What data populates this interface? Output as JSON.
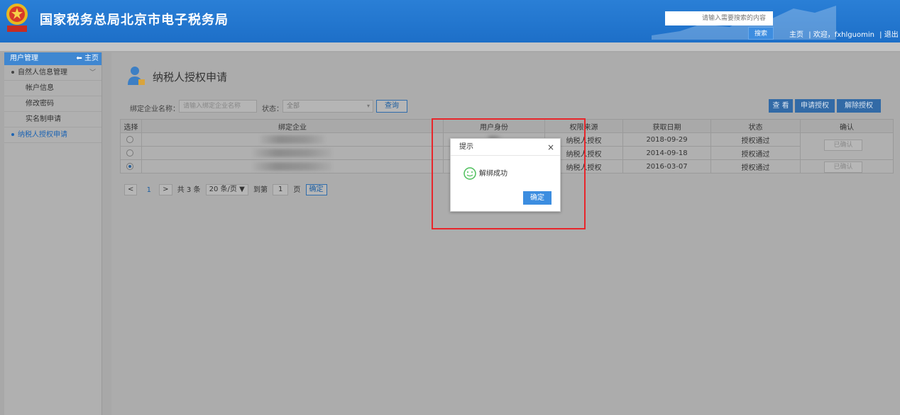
{
  "header": {
    "title": "国家税务总局北京市电子税务局",
    "search_placeholder": "请输入需要搜索的内容",
    "search_button": "搜索",
    "links": [
      "主页",
      "| 欢迎，fxhlguomin",
      "| 退出"
    ]
  },
  "sidebar": {
    "head_label": "用户管理",
    "home_label": "主页",
    "items": [
      {
        "label": "自然人信息管理"
      },
      {
        "label": "帐户信息"
      },
      {
        "label": "修改密码"
      },
      {
        "label": "实名制申请"
      },
      {
        "label": "纳税人授权申请"
      }
    ]
  },
  "main": {
    "page_title": "纳税人授权申请",
    "filter": {
      "company_label": "绑定企业名称：",
      "company_placeholder": "请输入绑定企业名称",
      "status_label": "状态：",
      "status_value": "全部",
      "query_button": "查询"
    },
    "toolbar": {
      "view": "查 看",
      "apply": "申请授权",
      "release": "解除授权"
    },
    "table": {
      "columns": [
        "选择",
        "绑定企业",
        "用户身份",
        "权限来源",
        "获取日期",
        "状态",
        "确认"
      ],
      "rows": [
        {
          "selected": false,
          "source": "纳税人授权",
          "date": "2018-09-29",
          "status": "授权通过"
        },
        {
          "selected": false,
          "source": "纳税人授权",
          "date": "2014-09-18",
          "status": "授权通过"
        },
        {
          "selected": true,
          "source": "纳税人授权",
          "date": "2016-03-07",
          "status": "授权通过"
        }
      ],
      "confirmed_label": "已确认"
    },
    "pager": {
      "prev": "<",
      "page": "1",
      "next": ">",
      "total": "共 3 条",
      "per_page": "20 条/页 ▼",
      "goto_label": "到第",
      "goto_value": "1",
      "page_unit": "页",
      "confirm": "确定"
    }
  },
  "dialog": {
    "title": "提示",
    "close": "×",
    "message": "解绑成功",
    "ok": "确定"
  },
  "colors": {
    "header_blue": "#1d6fc8",
    "accent_blue": "#3c8de0",
    "highlight_red": "#e8262b"
  }
}
